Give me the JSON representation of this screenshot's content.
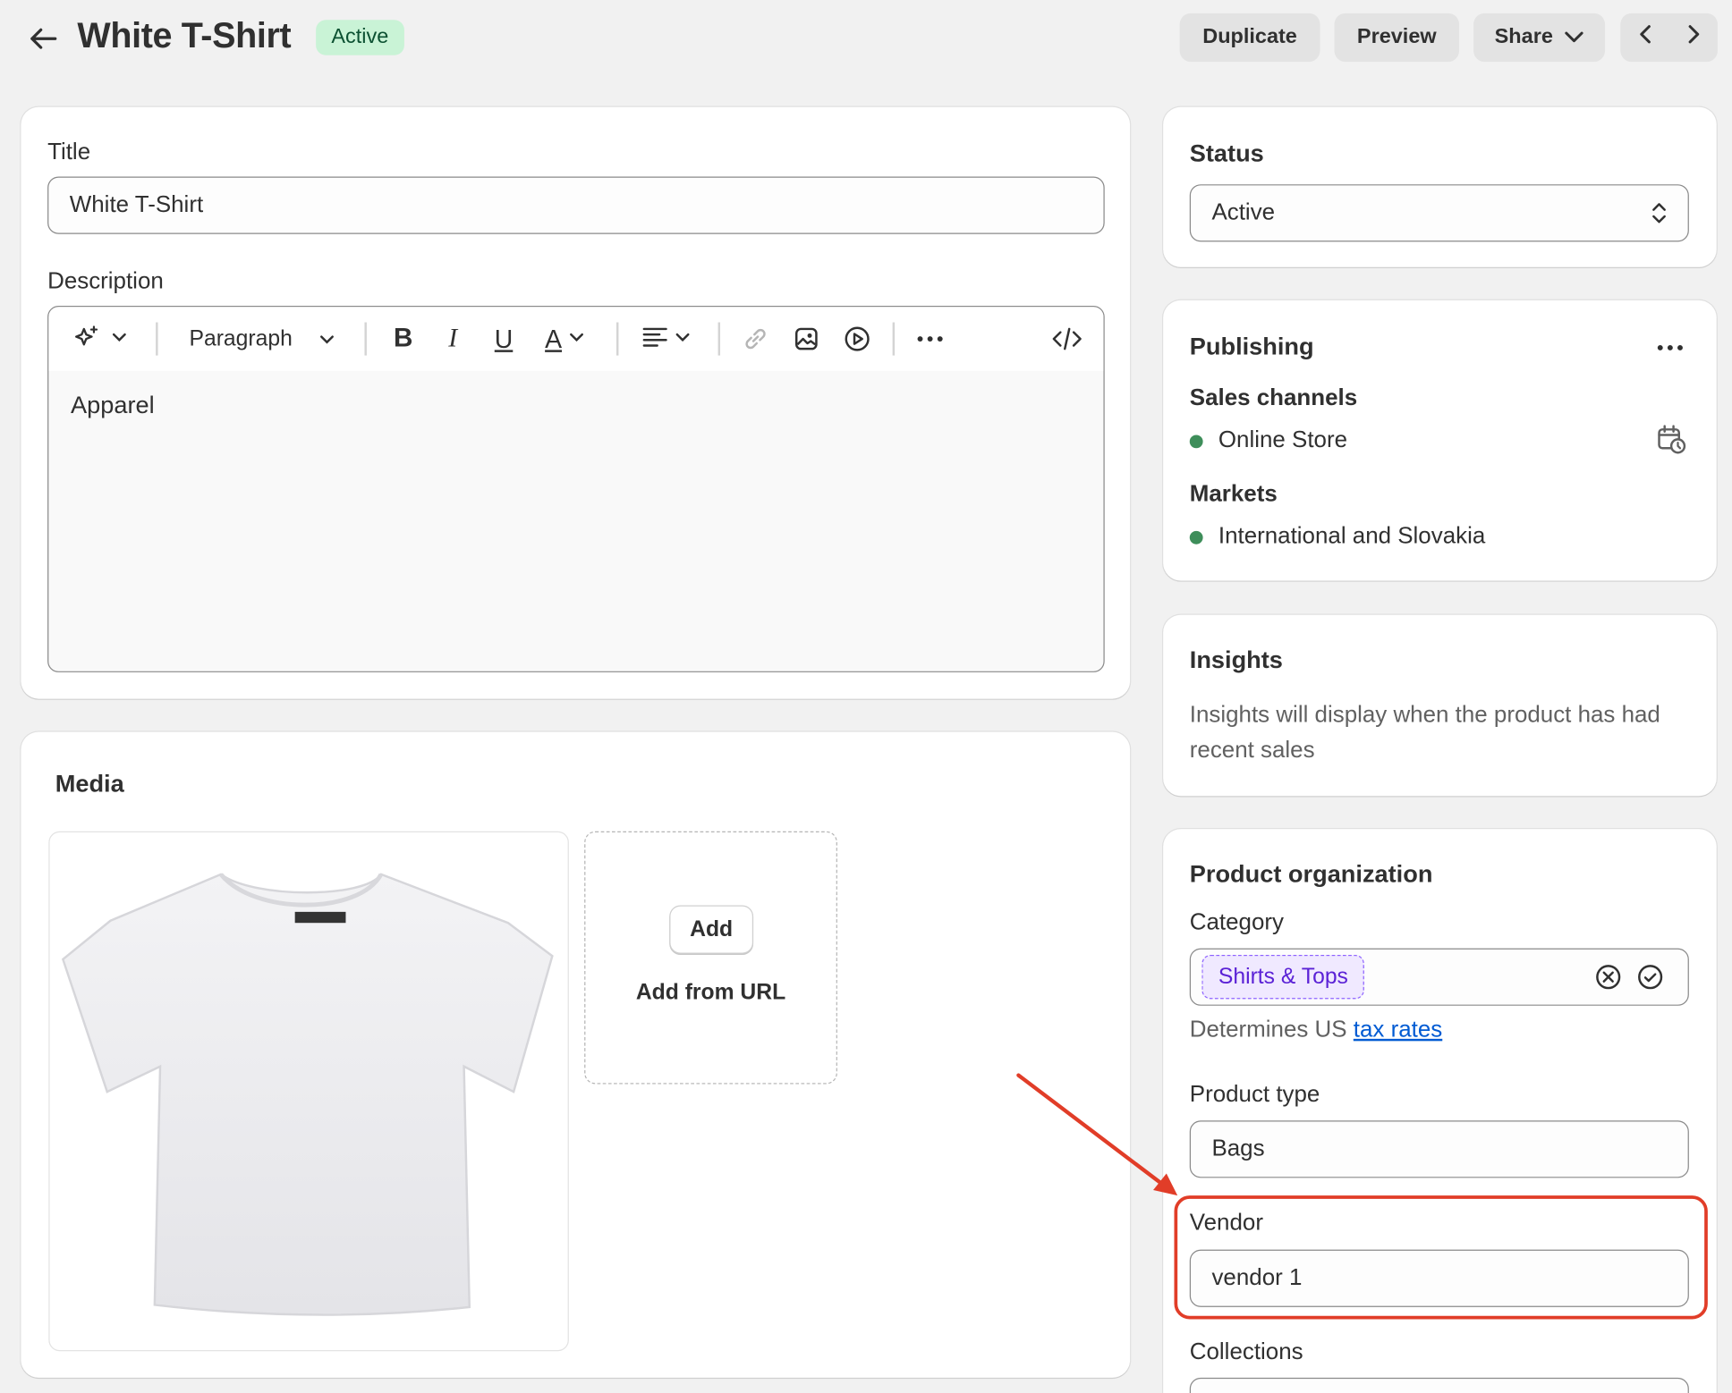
{
  "header": {
    "title": "White T-Shirt",
    "status_badge": "Active",
    "duplicate_label": "Duplicate",
    "preview_label": "Preview",
    "share_label": "Share"
  },
  "product": {
    "title_label": "Title",
    "title_value": "White T-Shirt",
    "description_label": "Description",
    "format_select": "Paragraph",
    "description_text": "Apparel"
  },
  "media": {
    "heading": "Media",
    "add_label": "Add",
    "add_from_url_label": "Add from URL"
  },
  "status_card": {
    "heading": "Status",
    "value": "Active"
  },
  "publishing": {
    "heading": "Publishing",
    "sales_channels_label": "Sales channels",
    "channel": "Online Store",
    "markets_label": "Markets",
    "market": "International and Slovakia"
  },
  "insights": {
    "heading": "Insights",
    "text": "Insights will display when the product has had recent sales"
  },
  "organization": {
    "heading": "Product organization",
    "category_label": "Category",
    "category_value": "Shirts & Tops",
    "category_help_prefix": "Determines US",
    "category_help_link": "tax rates",
    "product_type_label": "Product type",
    "product_type_value": "Bags",
    "vendor_label": "Vendor",
    "vendor_value": "vendor 1",
    "collections_label": "Collections"
  },
  "colors": {
    "background": "#f1f1f1",
    "badge_bg": "#c9f3d6",
    "badge_text": "#0c5132",
    "status_dot": "#3e8e5a",
    "link": "#005bd3",
    "category_chip": "#5b22d6",
    "annotation": "#e13d28"
  }
}
